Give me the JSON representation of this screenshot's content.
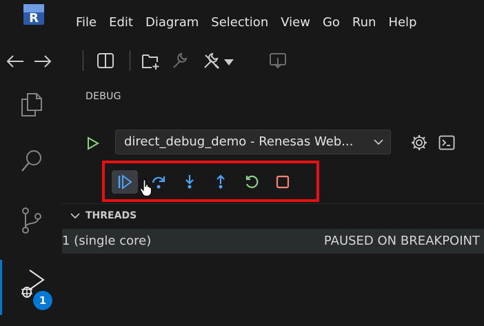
{
  "menubar": {
    "items": [
      "File",
      "Edit",
      "Diagram",
      "Selection",
      "View",
      "Go",
      "Run",
      "Help"
    ]
  },
  "activitybar": {
    "icons": [
      "explorer-icon",
      "search-icon",
      "source-control-icon",
      "run-debug-icon"
    ],
    "debug_badge": "1"
  },
  "sidebar": {
    "title": "DEBUG",
    "config_label": "direct_debug_demo - Renesas Web...",
    "toolbar_buttons": [
      "continue",
      "step-over",
      "step-into",
      "step-out",
      "restart",
      "stop"
    ],
    "threads": {
      "header": "THREADS",
      "rows": [
        {
          "name": "1 (single core)",
          "status": "PAUSED ON BREAKPOINT"
        }
      ]
    }
  },
  "colors": {
    "accent": "#0078d4",
    "highlight_box": "#e81010",
    "debug_blue": "#4fa3f7",
    "run_green": "#89d185",
    "stop_red": "#f48771"
  }
}
